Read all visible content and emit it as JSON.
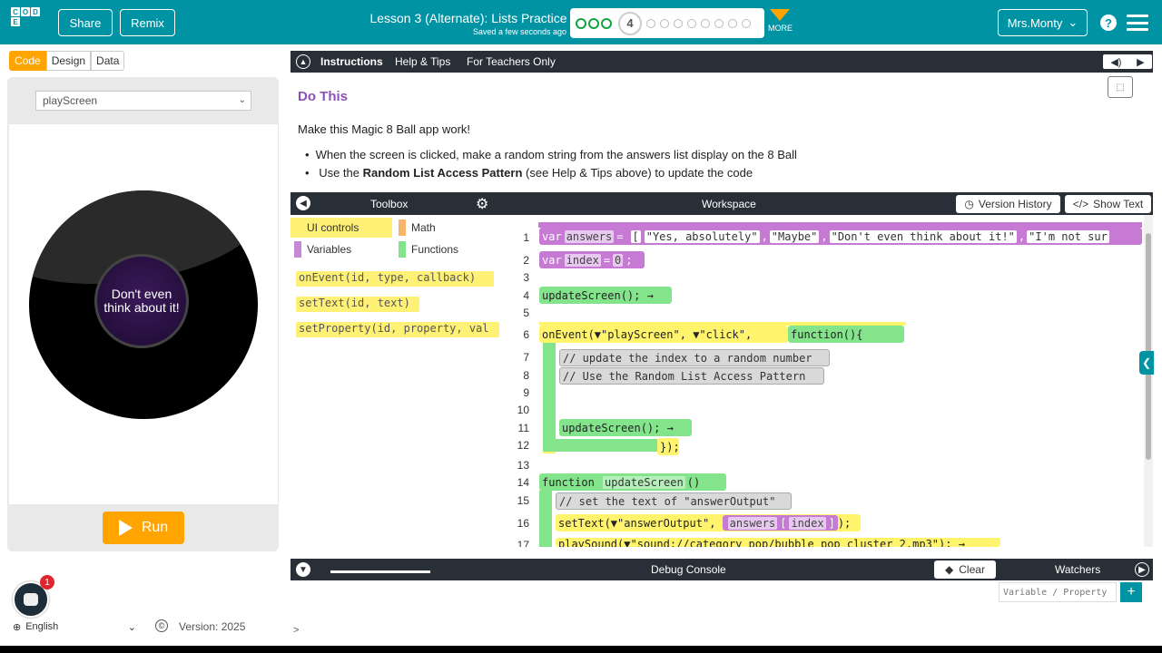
{
  "header": {
    "logo_letters": [
      "C",
      "O",
      "D",
      "E"
    ],
    "share_label": "Share",
    "remix_label": "Remix",
    "lesson_title": "Lesson 3 (Alternate): Lists Practice",
    "saved_status": "Saved a few seconds ago",
    "current_level": "4",
    "more_label": "MORE",
    "user_name": "Mrs.Monty",
    "help_label": "?"
  },
  "mode_tabs": [
    "Code",
    "Design",
    "Data"
  ],
  "app": {
    "screen_select": "playScreen",
    "answer_text": "Don't even think about it!",
    "run_label": "Run",
    "notification_count": "1",
    "language": "English",
    "version": "Version: 2025"
  },
  "instructions": {
    "tabs": [
      "Instructions",
      "Help & Tips",
      "For Teachers Only"
    ],
    "heading": "Do This",
    "paragraph": "Make this Magic 8 Ball app work!",
    "bullet1": "When the screen is clicked, make a random string from the answers list display on the 8 Ball",
    "bullet2_pre": "Use the ",
    "bullet2_bold": "Random List Access Pattern",
    "bullet2_post": " (see Help & Tips above) to update the code"
  },
  "toolbox": {
    "title": "Toolbox",
    "categories": [
      "UI controls",
      "Math",
      "Variables",
      "Functions"
    ],
    "palette": [
      "onEvent(id, type, callback)",
      "setText(id, text)",
      "setProperty(id, property, val"
    ]
  },
  "workspace": {
    "title": "Workspace",
    "version_history": "Version History",
    "show_text": "Show Text",
    "code": {
      "l1_var": "var",
      "l1_name": "answers",
      "l1_vals": [
        "\"Yes, absolutely\"",
        "\"Maybe\"",
        "\"Don't even think about it!\"",
        "\"I'm not sur"
      ],
      "l2_var": "var",
      "l2_name": "index",
      "l2_val": "0",
      "l4": "updateScreen(); →",
      "l6_event": "onEvent(",
      "l6_id": "\"playScreen\"",
      "l6_type": "\"click\"",
      "l6_fn": "function(){",
      "l7": "// update the index to a random number",
      "l8": "// Use the Random List Access Pattern",
      "l11": "updateScreen(); →",
      "l12": "});",
      "l14_kw": "function",
      "l14_name": "updateScreen",
      "l15": "// set the text of \"answerOutput\"",
      "l16_fn": "setText(",
      "l16_id": "\"answerOutput\"",
      "l16_list": "answers",
      "l16_idx": "index",
      "l17": "playSound(▼\"sound://category_pop/bubble_pop_cluster_2.mp3\"); →"
    },
    "line_numbers": [
      "1",
      "2",
      "3",
      "4",
      "5",
      "6",
      "7",
      "8",
      "9",
      "10",
      "11",
      "12",
      "13",
      "14",
      "15",
      "16",
      "17"
    ]
  },
  "debug": {
    "title": "Debug Console",
    "clear_label": "Clear",
    "watchers_label": "Watchers",
    "watch_placeholder": "Variable / Property",
    "prompt": ">"
  }
}
